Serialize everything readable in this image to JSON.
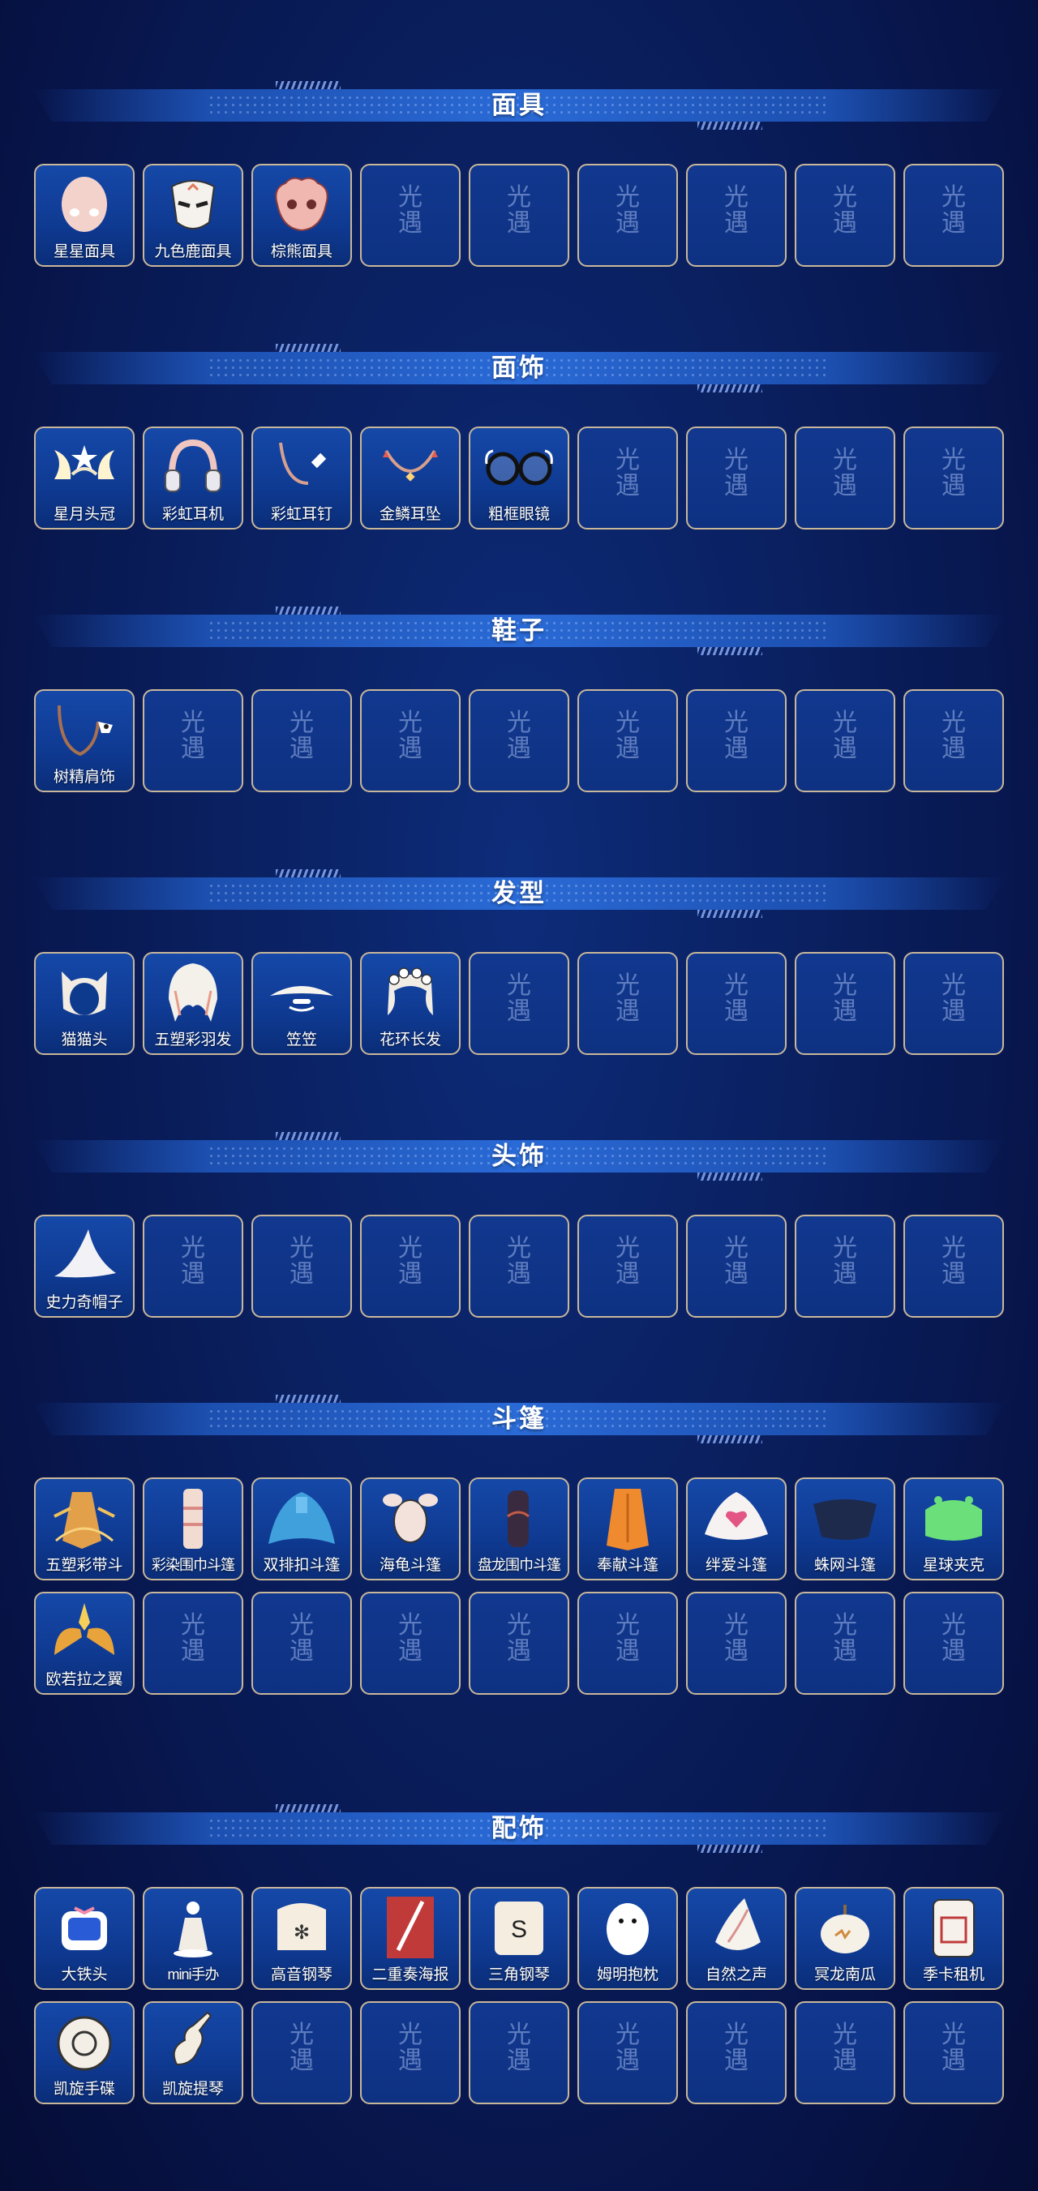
{
  "placeholder": {
    "top": "光",
    "bottom": "遇"
  },
  "sections": [
    {
      "title": "面具",
      "rows": [
        [
          {
            "label": "星星面具",
            "icon": "star-mask-icon"
          },
          {
            "label": "九色鹿面具",
            "icon": "deer-mask-icon"
          },
          {
            "label": "棕熊面具",
            "icon": "bear-mask-icon"
          },
          {},
          {},
          {},
          {},
          {},
          {}
        ]
      ]
    },
    {
      "title": "面饰",
      "rows": [
        [
          {
            "label": "星月头冠",
            "icon": "star-moon-crown-icon"
          },
          {
            "label": "彩虹耳机",
            "icon": "rainbow-headphones-icon"
          },
          {
            "label": "彩虹耳钉",
            "icon": "rainbow-earring-icon"
          },
          {
            "label": "金鳞耳坠",
            "icon": "golden-scale-earring-icon"
          },
          {
            "label": "粗框眼镜",
            "icon": "glasses-icon"
          },
          {},
          {},
          {},
          {}
        ]
      ]
    },
    {
      "title": "鞋子",
      "rows": [
        [
          {
            "label": "树精肩饰",
            "icon": "tree-spirit-shoulder-icon"
          },
          {},
          {},
          {},
          {},
          {},
          {},
          {},
          {}
        ]
      ]
    },
    {
      "title": "发型",
      "rows": [
        [
          {
            "label": "猫猫头",
            "icon": "cat-head-hair-icon"
          },
          {
            "label": "五塑彩羽发",
            "icon": "feather-hair-icon"
          },
          {
            "label": "笠笠",
            "icon": "bamboo-hat-icon"
          },
          {
            "label": "花环长发",
            "icon": "flower-wreath-hair-icon"
          },
          {},
          {},
          {},
          {},
          {}
        ]
      ]
    },
    {
      "title": "头饰",
      "rows": [
        [
          {
            "label": "史力奇帽子",
            "icon": "pointed-hat-icon"
          },
          {},
          {},
          {},
          {},
          {},
          {},
          {},
          {}
        ]
      ]
    },
    {
      "title": "斗篷",
      "rows": [
        [
          {
            "label": "五塑彩带斗",
            "icon": "ribbon-cape-icon"
          },
          {
            "label": "彩染围巾斗篷",
            "icon": "scarf-cape-icon"
          },
          {
            "label": "双排扣斗篷",
            "icon": "double-button-cape-icon"
          },
          {
            "label": "海龟斗篷",
            "icon": "turtle-cape-icon"
          },
          {
            "label": "盘龙围巾斗篷",
            "icon": "dragon-scarf-cape-icon"
          },
          {
            "label": "奉献斗篷",
            "icon": "orange-cape-icon"
          },
          {
            "label": "绊爱斗篷",
            "icon": "heart-cape-icon"
          },
          {
            "label": "蛛网斗篷",
            "icon": "spiderweb-cape-icon"
          },
          {
            "label": "星球夹克",
            "icon": "planet-jacket-icon"
          }
        ],
        [
          {
            "label": "欧若拉之翼",
            "icon": "aurora-wings-icon"
          },
          {},
          {},
          {},
          {},
          {},
          {},
          {},
          {}
        ]
      ]
    },
    {
      "title": "配饰",
      "rows": [
        [
          {
            "label": "大铁头",
            "icon": "tv-head-icon"
          },
          {
            "label": "mini手办",
            "icon": "mini-figure-icon"
          },
          {
            "label": "高音钢琴",
            "icon": "treble-piano-icon"
          },
          {
            "label": "二重奏海报",
            "icon": "duet-poster-icon"
          },
          {
            "label": "三角钢琴",
            "icon": "grand-piano-icon"
          },
          {
            "label": "姆明抱枕",
            "icon": "moomin-pillow-icon"
          },
          {
            "label": "自然之声",
            "icon": "conch-shell-icon"
          },
          {
            "label": "冥龙南瓜",
            "icon": "pumpkin-icon"
          },
          {
            "label": "季卡租机",
            "icon": "card-machine-icon"
          }
        ],
        [
          {
            "label": "凯旋手碟",
            "icon": "handpan-icon"
          },
          {
            "label": "凯旋提琴",
            "icon": "violin-icon"
          },
          {},
          {},
          {},
          {},
          {},
          {},
          {}
        ]
      ]
    }
  ]
}
